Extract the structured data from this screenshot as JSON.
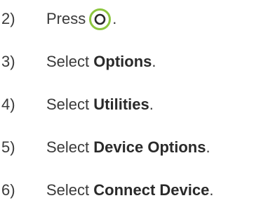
{
  "colors": {
    "text": "#3a3a3a",
    "button_ring": "#8cc63f",
    "button_glyph": "#2a2a2a"
  },
  "steps": [
    {
      "number": "2)",
      "verb": "Press",
      "icon": "xbox-b-button-icon",
      "punct": "."
    },
    {
      "number": "3)",
      "verb": "Select",
      "target": "Options",
      "punct": "."
    },
    {
      "number": "4)",
      "verb": "Select",
      "target": "Utilities",
      "punct": "."
    },
    {
      "number": "5)",
      "verb": "Select",
      "target": "Device Options",
      "punct": "."
    },
    {
      "number": "6)",
      "verb": "Select",
      "target": "Connect Device",
      "punct": "."
    }
  ]
}
